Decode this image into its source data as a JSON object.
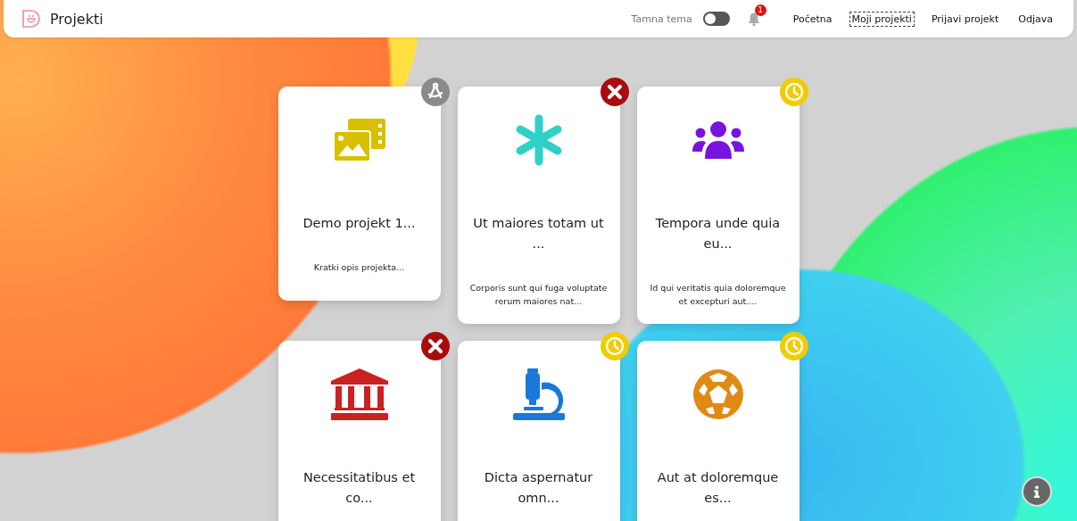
{
  "header": {
    "title": "Projekti",
    "theme_toggle": {
      "label": "Tamna tema",
      "on": false
    },
    "notifications": {
      "count": "1"
    },
    "nav": [
      {
        "label": "Početna",
        "selected": false
      },
      {
        "label": "Moji projekti",
        "selected": true
      },
      {
        "label": "Prijavi projekt",
        "selected": false
      },
      {
        "label": "Odjava",
        "selected": false
      }
    ]
  },
  "projects": [
    {
      "kind": "images",
      "badge": {
        "kind": "draft"
      },
      "title": "Demo projekt 1...",
      "description": "Kratki opis projekta..."
    },
    {
      "kind": "asterisk",
      "badge": {
        "kind": "rejected"
      },
      "title": "Ut maiores totam ut ...",
      "description": "Corporis sunt qui fuga voluptate rerum maiores nat..."
    },
    {
      "kind": "users",
      "badge": {
        "kind": "pending"
      },
      "title": "Tempora unde quia eu...",
      "description": "Id qui veritatis quia doloremque et excepturi aut...."
    },
    {
      "kind": "building",
      "badge": {
        "kind": "rejected"
      },
      "title": "Necessitatibus et co..."
    },
    {
      "kind": "microscope",
      "badge": {
        "kind": "pending"
      },
      "title": "Dicta aspernatur omn..."
    },
    {
      "kind": "ball",
      "badge": {
        "kind": "pending"
      },
      "title": "Aut at doloremque es..."
    }
  ]
}
